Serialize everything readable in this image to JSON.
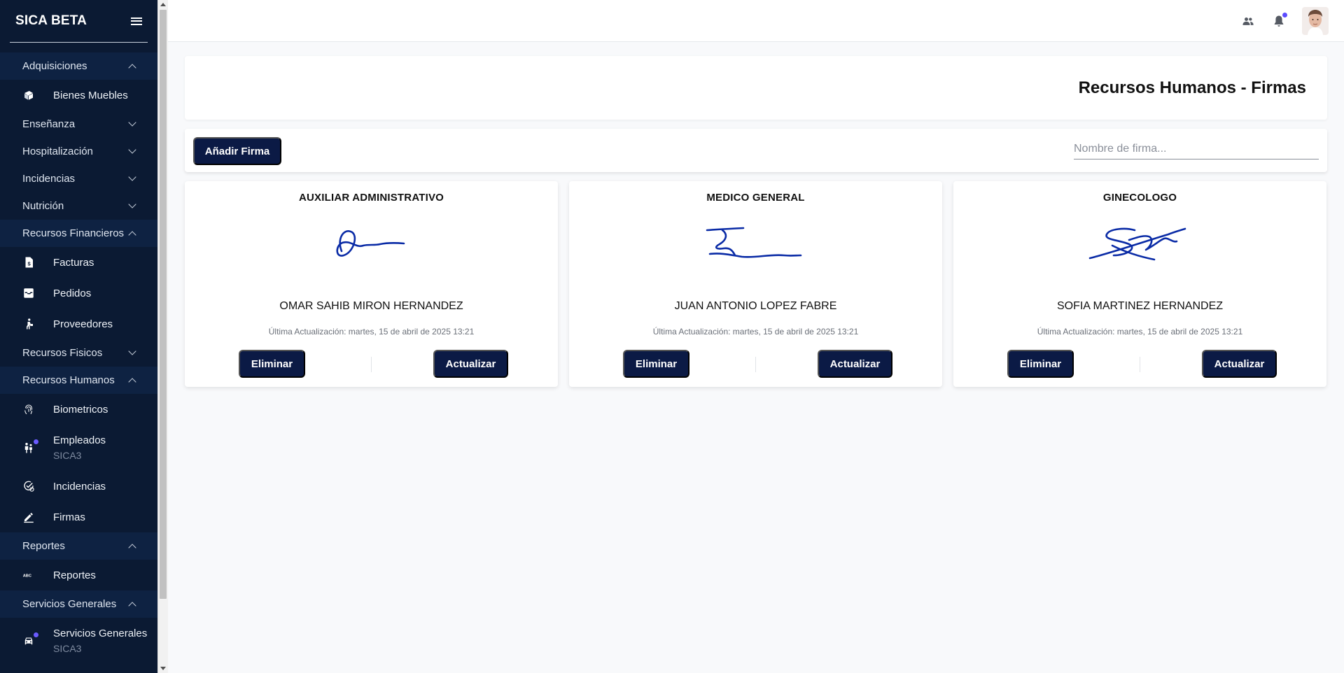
{
  "sidebar": {
    "brand": "SICA BETA",
    "sections": [
      {
        "label": "Adquisiciones",
        "open": true,
        "items": [
          {
            "label": "Bienes Muebles",
            "icon": "box-icon"
          }
        ]
      },
      {
        "label": "Enseñanza",
        "open": false,
        "items": []
      },
      {
        "label": "Hospitalización",
        "open": false,
        "items": []
      },
      {
        "label": "Incidencias",
        "open": false,
        "items": []
      },
      {
        "label": "Nutrición",
        "open": false,
        "items": []
      },
      {
        "label": "Recursos Financieros",
        "open": true,
        "items": [
          {
            "label": "Facturas",
            "icon": "invoice-icon"
          },
          {
            "label": "Pedidos",
            "icon": "inbox-icon"
          },
          {
            "label": "Proveedores",
            "icon": "delivery-person-icon"
          }
        ]
      },
      {
        "label": "Recursos Fisicos",
        "open": false,
        "items": []
      },
      {
        "label": "Recursos Humanos",
        "open": true,
        "items": [
          {
            "label": "Biometricos",
            "icon": "fingerprint-icon"
          },
          {
            "label": "Empleados",
            "sub": "SICA3",
            "icon": "people-icon"
          },
          {
            "label": "Incidencias",
            "icon": "check-clock-icon"
          },
          {
            "label": "Firmas",
            "icon": "pen-icon"
          }
        ]
      },
      {
        "label": "Reportes",
        "open": true,
        "items": [
          {
            "label": "Reportes",
            "icon": "abc-icon"
          }
        ]
      },
      {
        "label": "Servicios Generales",
        "open": true,
        "items": [
          {
            "label": "Servicios Generales",
            "sub": "SICA3",
            "icon": "car-icon"
          }
        ]
      }
    ]
  },
  "colors": {
    "sidebar_bg": "#0b1a33",
    "accent_dark": "#0b1a45",
    "signature": "#0a2ba6",
    "badge": "#5b4bff"
  },
  "page": {
    "title": "Recursos Humanos - Firmas"
  },
  "toolbar": {
    "add_label": "Añadir Firma",
    "search_placeholder": "Nombre de firma..."
  },
  "cards": [
    {
      "title": "AUXILIAR ADMINISTRATIVO",
      "name": "OMAR SAHIB MIRON HERNANDEZ",
      "updated": "Última Actualización: martes, 15 de abril de 2025 13:21",
      "delete_label": "Eliminar",
      "update_label": "Actualizar"
    },
    {
      "title": "MEDICO GENERAL",
      "name": "JUAN ANTONIO LOPEZ FABRE",
      "updated": "Última Actualización: martes, 15 de abril de 2025 13:21",
      "delete_label": "Eliminar",
      "update_label": "Actualizar"
    },
    {
      "title": "GINECOLOGO",
      "name": "SOFIA MARTINEZ HERNANDEZ",
      "updated": "Última Actualización: martes, 15 de abril de 2025 13:21",
      "delete_label": "Eliminar",
      "update_label": "Actualizar"
    }
  ]
}
